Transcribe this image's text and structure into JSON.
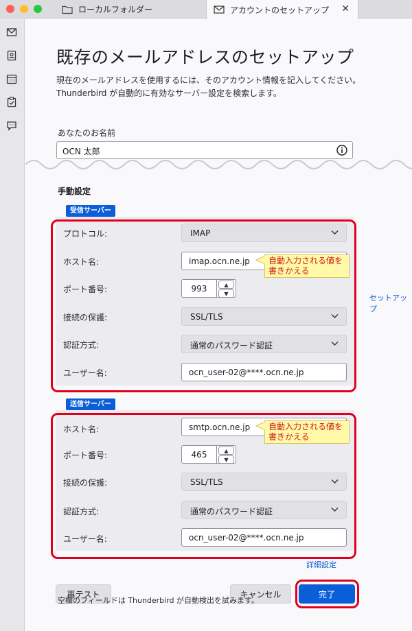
{
  "tabs": [
    {
      "label": "ローカルフォルダー",
      "icon": "folder-icon"
    },
    {
      "label": "アカウントのセットアップ",
      "icon": "envelope-icon",
      "close": "✕"
    }
  ],
  "spaces": [
    "mail-icon",
    "address-book-icon",
    "calendar-icon",
    "tasks-icon",
    "chat-icon"
  ],
  "header": {
    "title": "既存のメールアドレスのセットアップ",
    "description_line1": "現在のメールアドレスを使用するには、そのアカウント情報を記入してください。",
    "description_line2": "Thunderbird が自動的に有効なサーバー設定を検索します。"
  },
  "name_field": {
    "label": "あなたのお名前",
    "value": "OCN 太郎"
  },
  "manual": {
    "title": "手動設定",
    "incoming": {
      "badge": "受信サーバー",
      "protocol_label": "プロトコル:",
      "protocol_value": "IMAP",
      "host_label": "ホスト名:",
      "host_value": "imap.ocn.ne.jp",
      "port_label": "ポート番号:",
      "port_value": "993",
      "security_label": "接続の保護:",
      "security_value": "SSL/TLS",
      "auth_label": "認証方式:",
      "auth_value": "通常のパスワード認証",
      "user_label": "ユーザー名:",
      "user_value": "ocn_user-02@****.ocn.ne.jp"
    },
    "outgoing": {
      "badge": "送信サーバー",
      "host_label": "ホスト名:",
      "host_value": "smtp.ocn.ne.jp",
      "port_label": "ポート番号:",
      "port_value": "465",
      "security_label": "接続の保護:",
      "security_value": "SSL/TLS",
      "auth_label": "認証方式:",
      "auth_value": "通常のパスワード認証",
      "user_label": "ユーザー名:",
      "user_value": "ocn_user-02@****.ocn.ne.jp"
    },
    "callout_line1": "自動入力される値を",
    "callout_line2": "書きかえる",
    "advanced_link": "詳細設定",
    "setup_link": "セットアップ"
  },
  "buttons": {
    "retest": "再テスト",
    "cancel": "キャンセル",
    "done": "完了"
  },
  "footer": "空欄のフィールドは Thunderbird が自動検出を試みます。",
  "colors": {
    "accent": "#0a5ed7",
    "highlight": "#e1001b",
    "callout_bg": "#fff9a8",
    "callout_text": "#d0141b"
  }
}
